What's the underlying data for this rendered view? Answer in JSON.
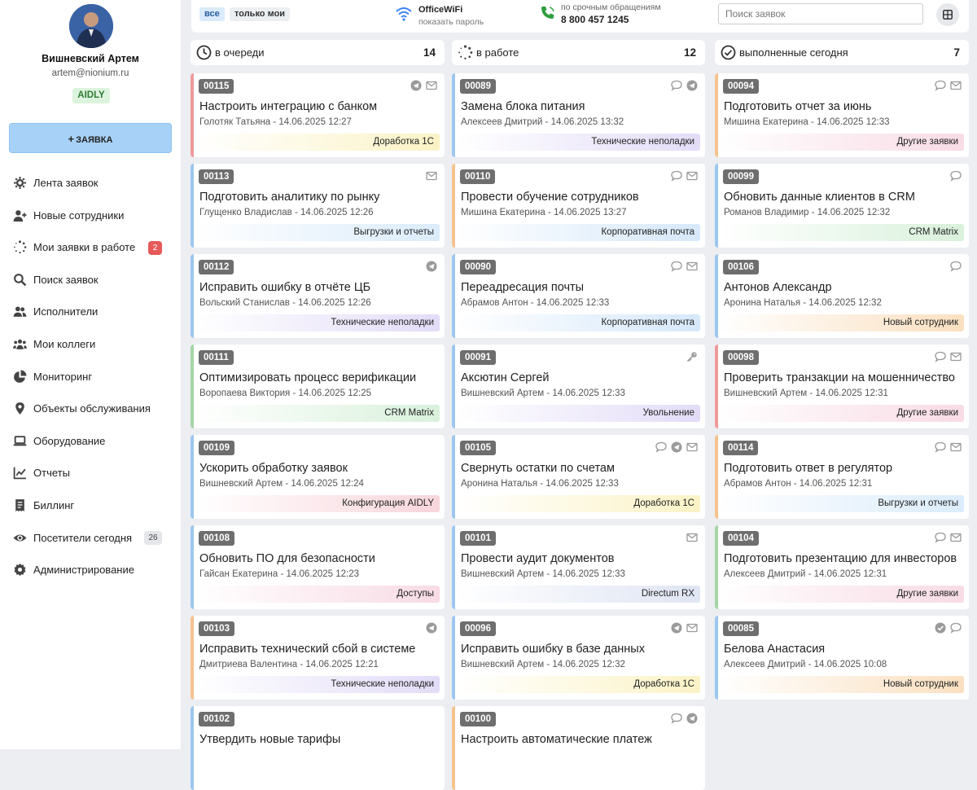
{
  "user": {
    "name": "Вишневский Артем",
    "email": "artem@nionium.ru",
    "badge": "AIDLY"
  },
  "new_request_label": "ЗАЯВКА",
  "nav": [
    {
      "label": "Лента заявок",
      "icon": "gear-icon"
    },
    {
      "label": "Новые сотрудники",
      "icon": "user-plus-icon"
    },
    {
      "label": "Мои заявки в работе",
      "icon": "spinner-icon",
      "count": "2"
    },
    {
      "label": "Поиск заявок",
      "icon": "search-icon"
    },
    {
      "label": "Исполнители",
      "icon": "users-icon"
    },
    {
      "label": "Мои коллеги",
      "icon": "users-group-icon"
    },
    {
      "label": "Мониторинг",
      "icon": "pie-chart-icon"
    },
    {
      "label": "Объекты обслуживания",
      "icon": "map-pin-icon"
    },
    {
      "label": "Оборудование",
      "icon": "laptop-icon"
    },
    {
      "label": "Отчеты",
      "icon": "line-chart-icon"
    },
    {
      "label": "Биллинг",
      "icon": "receipt-icon"
    },
    {
      "label": "Посетители сегодня",
      "icon": "eye-icon",
      "count": "26"
    },
    {
      "label": "Администрирование",
      "icon": "cog-icon"
    }
  ],
  "topbar": {
    "filter_all": "все",
    "filter_mine": "только мои",
    "wifi_title": "OfficeWiFi",
    "wifi_sub": "показать пароль",
    "phone_title": "по срочным обращениям",
    "phone_number": "8 800 457 1245",
    "search_placeholder": "Поиск заявок"
  },
  "columns": [
    {
      "title": "в очереди",
      "count": "14",
      "icon": "clock-icon",
      "cards": [
        {
          "id": "00115",
          "title": "Настроить интеграцию с банком",
          "meta": "Голотяк Татьяна - 14.06.2025 12:27",
          "tag": "Доработка 1С",
          "border": "#ef9a9a",
          "tag_color": "#fbf3c6",
          "icons": [
            "telegram",
            "mail"
          ]
        },
        {
          "id": "00113",
          "title": "Подготовить аналитику по рынку",
          "meta": "Глущенко Владислав - 14.06.2025 12:26",
          "tag": "Выгрузки и отчеты",
          "border": "#9cc7f0",
          "tag_color": "#dbecfb",
          "icons": [
            "mail"
          ]
        },
        {
          "id": "00112",
          "title": "Исправить ошибку в отчёте ЦБ",
          "meta": "Вольский Станислав - 14.06.2025 12:26",
          "tag": "Технические неполадки",
          "border": "#9cc7f0",
          "tag_color": "#e3dcf7",
          "icons": [
            "telegram"
          ]
        },
        {
          "id": "00111",
          "title": "Оптимизировать процесс верификации",
          "meta": "Воропаева Виктория - 14.06.2025 12:25",
          "tag": "CRM Matrix",
          "border": "#a5d6a7",
          "tag_color": "#d9f1dc",
          "icons": []
        },
        {
          "id": "00109",
          "title": "Ускорить обработку заявок",
          "meta": "Вишневский Артем - 14.06.2025 12:24",
          "tag": "Конфигурация AIDLY",
          "border": "#9cc7f0",
          "tag_color": "#f8d6dc",
          "icons": []
        },
        {
          "id": "00108",
          "title": "Обновить ПО для безопасности",
          "meta": "Гайсан Екатерина - 14.06.2025 12:23",
          "tag": "Доступы",
          "border": "#9cc7f0",
          "tag_color": "#f8dbe5",
          "icons": []
        },
        {
          "id": "00103",
          "title": "Исправить технический сбой в системе",
          "meta": "Дмитриева Валентина - 14.06.2025 12:21",
          "tag": "Технические неполадки",
          "border": "#f6c28f",
          "tag_color": "#e3dcf7",
          "icons": [
            "telegram"
          ]
        },
        {
          "id": "00102",
          "title": "Утвердить новые тарифы",
          "meta": "",
          "tag": "",
          "border": "#9cc7f0",
          "tag_color": "#ffffff",
          "icons": []
        }
      ]
    },
    {
      "title": "в работе",
      "count": "12",
      "icon": "spinner-icon",
      "cards": [
        {
          "id": "00089",
          "title": "Замена блока питания",
          "meta": "Алексеев Дмитрий - 14.06.2025 13:32",
          "tag": "Технические неполадки",
          "border": "#9cc7f0",
          "tag_color": "#e3dcf7",
          "icons": [
            "chat",
            "telegram"
          ]
        },
        {
          "id": "00110",
          "title": "Провести обучение сотрудников",
          "meta": "Мишина Екатерина - 14.06.2025 13:27",
          "tag": "Корпоративная почта",
          "border": "#f6c28f",
          "tag_color": "#d6e8fa",
          "icons": [
            "chat",
            "mail"
          ]
        },
        {
          "id": "00090",
          "title": "Переадресация почты",
          "meta": "Абрамов Антон - 14.06.2025 12:33",
          "tag": "Корпоративная почта",
          "border": "#9cc7f0",
          "tag_color": "#d6e8fa",
          "icons": [
            "chat",
            "mail"
          ]
        },
        {
          "id": "00091",
          "title": "Аксютин Сергей",
          "meta": "Вишневский Артем - 14.06.2025 12:33",
          "tag": "Увольнение",
          "border": "#9cc7f0",
          "tag_color": "#e3dcf7",
          "icons": [
            "key"
          ]
        },
        {
          "id": "00105",
          "title": "Свернуть остатки по счетам",
          "meta": "Аронина Наталья - 14.06.2025 12:33",
          "tag": "Доработка 1С",
          "border": "#9cc7f0",
          "tag_color": "#fbf3c6",
          "icons": [
            "chat",
            "telegram",
            "mail"
          ]
        },
        {
          "id": "00101",
          "title": "Провести аудит документов",
          "meta": "Вишневский Артем - 14.06.2025 12:33",
          "tag": "Directum RX",
          "border": "#9cc7f0",
          "tag_color": "#dfe5f3",
          "icons": [
            "mail"
          ]
        },
        {
          "id": "00096",
          "title": "Исправить ошибку в базе данных",
          "meta": "Вишневский Артем - 14.06.2025 12:32",
          "tag": "Доработка 1С",
          "border": "#9cc7f0",
          "tag_color": "#fbf3c6",
          "icons": [
            "telegram",
            "mail"
          ]
        },
        {
          "id": "00100",
          "title": "Настроить автоматические платеж",
          "meta": "",
          "tag": "",
          "border": "#f6c28f",
          "tag_color": "#ffffff",
          "icons": [
            "chat",
            "telegram"
          ]
        }
      ]
    },
    {
      "title": "выполненные сегодня",
      "count": "7",
      "icon": "check-circle-icon",
      "cards": [
        {
          "id": "00094",
          "title": "Подготовить отчет за июнь",
          "meta": "Мишина Екатерина - 14.06.2025 12:33",
          "tag": "Другие заявки",
          "border": "#f6c28f",
          "tag_color": "#f8dbe5",
          "icons": [
            "chat",
            "mail"
          ]
        },
        {
          "id": "00099",
          "title": "Обновить данные клиентов в CRM",
          "meta": "Романов Владимир - 14.06.2025 12:32",
          "tag": "CRM Matrix",
          "border": "#9cc7f0",
          "tag_color": "#d9f1dc",
          "icons": [
            "chat"
          ]
        },
        {
          "id": "00106",
          "title": "Антонов Александр",
          "meta": "Аронина Наталья - 14.06.2025 12:32",
          "tag": "Новый сотрудник",
          "border": "#9cc7f0",
          "tag_color": "#fae0c0",
          "icons": [
            "chat"
          ]
        },
        {
          "id": "00098",
          "title": "Проверить транзакции на мошенничество",
          "meta": "Вишневский Артем - 14.06.2025 12:31",
          "tag": "Другие заявки",
          "border": "#ef9a9a",
          "tag_color": "#f8dbe5",
          "icons": [
            "chat",
            "mail"
          ]
        },
        {
          "id": "00114",
          "title": "Подготовить ответ в регулятор",
          "meta": "Абрамов Антон - 14.06.2025 12:31",
          "tag": "Выгрузки и отчеты",
          "border": "#f6c28f",
          "tag_color": "#dbecfb",
          "icons": [
            "chat",
            "mail"
          ]
        },
        {
          "id": "00104",
          "title": "Подготовить презентацию для инвесторов",
          "meta": "Алексеев Дмитрий - 14.06.2025 12:31",
          "tag": "Другие заявки",
          "border": "#a5d6a7",
          "tag_color": "#f8dbe5",
          "icons": [
            "chat",
            "mail"
          ]
        },
        {
          "id": "00085",
          "title": "Белова Анастасия",
          "meta": "Алексеев Дмитрий - 14.06.2025 10:08",
          "tag": "Новый сотрудник",
          "border": "#9cc7f0",
          "tag_color": "#fae0c0",
          "icons": [
            "check",
            "chat"
          ]
        }
      ]
    }
  ]
}
